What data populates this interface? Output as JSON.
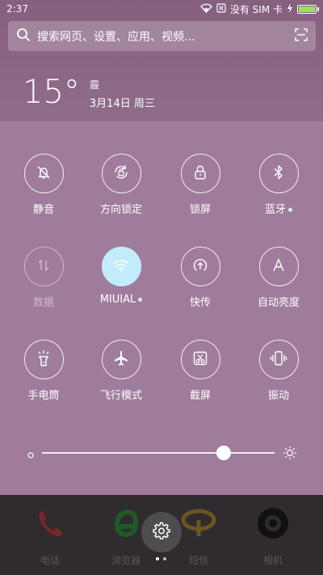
{
  "status_bar": {
    "time": "2:37",
    "sim_text": "没有 SIM 卡",
    "battery_color": "#9ee05d"
  },
  "search": {
    "placeholder": "搜索网页、设置、应用、视频..."
  },
  "weather": {
    "temperature": "15°",
    "condition": "霾",
    "date": "3月14日 周三"
  },
  "toggles": [
    {
      "label": "静音",
      "icon": "bell-muted-icon",
      "active": false,
      "disabled": false,
      "dot": false
    },
    {
      "label": "方向锁定",
      "icon": "rotation-lock-icon",
      "active": false,
      "disabled": false,
      "dot": false
    },
    {
      "label": "锁屏",
      "icon": "lock-icon",
      "active": false,
      "disabled": false,
      "dot": false
    },
    {
      "label": "蓝牙",
      "icon": "bluetooth-icon",
      "active": false,
      "disabled": false,
      "dot": true
    },
    {
      "label": "数据",
      "icon": "mobile-data-icon",
      "active": false,
      "disabled": true,
      "dot": false
    },
    {
      "label": "MIUIAL",
      "icon": "wifi-icon",
      "active": true,
      "disabled": false,
      "dot": true
    },
    {
      "label": "快传",
      "icon": "quick-share-icon",
      "active": false,
      "disabled": false,
      "dot": false
    },
    {
      "label": "自动亮度",
      "icon": "auto-brightness-icon",
      "active": false,
      "disabled": false,
      "dot": false
    },
    {
      "label": "手电筒",
      "icon": "flashlight-icon",
      "active": false,
      "disabled": false,
      "dot": false
    },
    {
      "label": "飞行模式",
      "icon": "airplane-icon",
      "active": false,
      "disabled": false,
      "dot": false
    },
    {
      "label": "截屏",
      "icon": "screenshot-icon",
      "active": false,
      "disabled": false,
      "dot": false
    },
    {
      "label": "振动",
      "icon": "vibrate-icon",
      "active": false,
      "disabled": false,
      "dot": false
    }
  ],
  "brightness": {
    "level": 0.78
  },
  "dock": {
    "apps": [
      {
        "label": "电话",
        "icon": "phone-icon",
        "color": "#c0282a"
      },
      {
        "label": "浏览器",
        "icon": "browser-icon",
        "color": "#2f9a3a"
      },
      {
        "label": "短信",
        "icon": "messages-icon",
        "color": "#d8a22a"
      },
      {
        "label": "相机",
        "icon": "camera-icon",
        "color": "#1a1a1a"
      }
    ]
  },
  "colors": {
    "active_toggle": "#c2ecfb",
    "panel_background": "#a07c9c"
  }
}
